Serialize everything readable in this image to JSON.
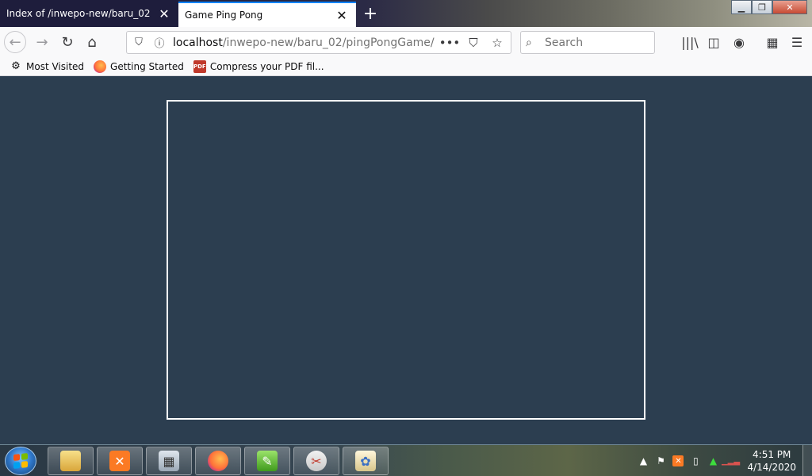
{
  "browser": {
    "tabs": [
      {
        "label": "Index of /inwepo-new/baru_02",
        "active": false
      },
      {
        "label": "Game Ping Pong",
        "active": true
      }
    ],
    "url": {
      "host": "localhost",
      "path": "/inwepo-new/baru_02/pingPongGame/"
    },
    "search_placeholder": "Search",
    "bookmarks": [
      {
        "label": "Most Visited",
        "icon": "gear-icon"
      },
      {
        "label": "Getting Started",
        "icon": "firefox-icon"
      },
      {
        "label": "Compress your PDF fil...",
        "icon": "pdf-icon"
      }
    ],
    "pdf_icon_text": "PDF"
  },
  "page": {
    "background": "#2c3e50",
    "board_border": "#ffffff"
  },
  "taskbar": {
    "clock_time": "4:51 PM",
    "clock_date": "4/14/2020"
  },
  "colors": {
    "accent": "#0a84ff",
    "tab_bar_dark": "#1e1d3c"
  }
}
